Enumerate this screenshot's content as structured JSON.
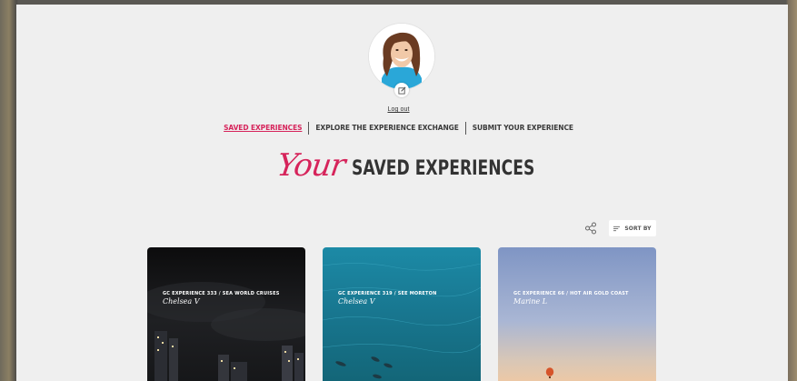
{
  "profile": {
    "logout_label": "Log out"
  },
  "nav": {
    "tabs": [
      {
        "label": "SAVED EXPERIENCES",
        "active": true
      },
      {
        "label": "EXPLORE THE EXPERIENCE EXCHANGE",
        "active": false
      },
      {
        "label": "SUBMIT YOUR EXPERIENCE",
        "active": false
      }
    ]
  },
  "heading": {
    "script": "Your",
    "title": "SAVED EXPERIENCES"
  },
  "toolbar": {
    "share_icon": "share-icon",
    "sort_icon": "sort-lines-icon",
    "sort_label": "SORT BY"
  },
  "cards": [
    {
      "label": "GC EXPERIENCE 333 / SEA WORLD CRUISES",
      "author": "Chelsea V"
    },
    {
      "label": "GC EXPERIENCE 319 / SEE MORETON",
      "author": "Chelsea V"
    },
    {
      "label": "GC EXPERIENCE 66 / HOT AIR GOLD COAST",
      "author": "Marine L"
    }
  ],
  "colors": {
    "accent": "#d6245b",
    "panel": "#efefef",
    "text": "#333333"
  }
}
